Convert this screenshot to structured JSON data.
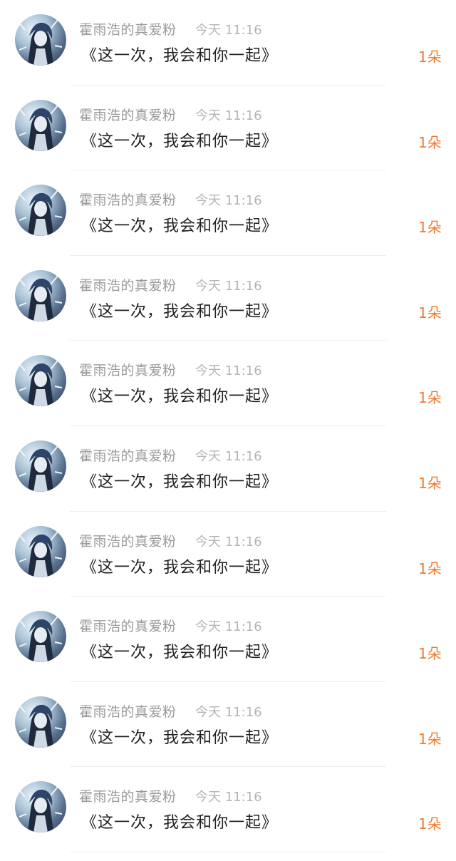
{
  "accent_color": "#ee7b31",
  "items": [
    {
      "user": "霍雨浩的真爱粉",
      "time": "今天 11:16",
      "title": "《这一次，我会和你一起》",
      "count": "1朵",
      "avatar_icon": "anime-avatar"
    },
    {
      "user": "霍雨浩的真爱粉",
      "time": "今天 11:16",
      "title": "《这一次，我会和你一起》",
      "count": "1朵",
      "avatar_icon": "anime-avatar"
    },
    {
      "user": "霍雨浩的真爱粉",
      "time": "今天 11:16",
      "title": "《这一次，我会和你一起》",
      "count": "1朵",
      "avatar_icon": "anime-avatar"
    },
    {
      "user": "霍雨浩的真爱粉",
      "time": "今天 11:16",
      "title": "《这一次，我会和你一起》",
      "count": "1朵",
      "avatar_icon": "anime-avatar"
    },
    {
      "user": "霍雨浩的真爱粉",
      "time": "今天 11:16",
      "title": "《这一次，我会和你一起》",
      "count": "1朵",
      "avatar_icon": "anime-avatar"
    },
    {
      "user": "霍雨浩的真爱粉",
      "time": "今天 11:16",
      "title": "《这一次，我会和你一起》",
      "count": "1朵",
      "avatar_icon": "anime-avatar"
    },
    {
      "user": "霍雨浩的真爱粉",
      "time": "今天 11:16",
      "title": "《这一次，我会和你一起》",
      "count": "1朵",
      "avatar_icon": "anime-avatar"
    },
    {
      "user": "霍雨浩的真爱粉",
      "time": "今天 11:16",
      "title": "《这一次，我会和你一起》",
      "count": "1朵",
      "avatar_icon": "anime-avatar"
    },
    {
      "user": "霍雨浩的真爱粉",
      "time": "今天 11:16",
      "title": "《这一次，我会和你一起》",
      "count": "1朵",
      "avatar_icon": "anime-avatar"
    },
    {
      "user": "霍雨浩的真爱粉",
      "time": "今天 11:16",
      "title": "《这一次，我会和你一起》",
      "count": "1朵",
      "avatar_icon": "anime-avatar"
    }
  ]
}
